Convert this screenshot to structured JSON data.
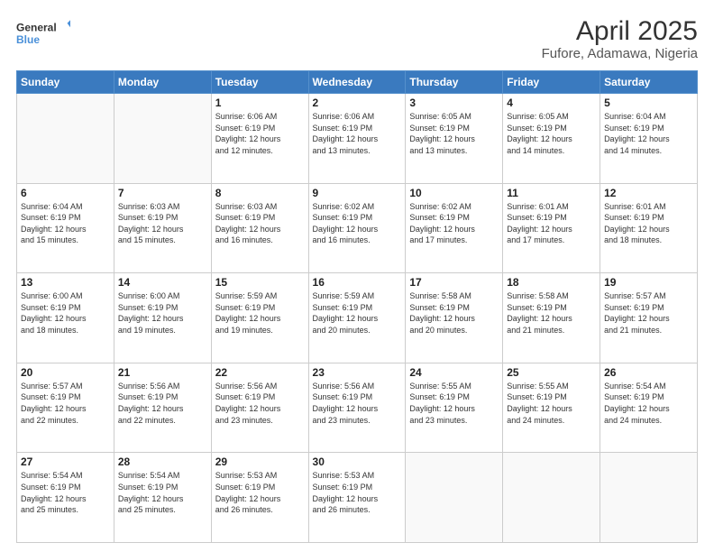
{
  "header": {
    "logo_line1": "General",
    "logo_line2": "Blue",
    "title": "April 2025",
    "subtitle": "Fufore, Adamawa, Nigeria"
  },
  "days_of_week": [
    "Sunday",
    "Monday",
    "Tuesday",
    "Wednesday",
    "Thursday",
    "Friday",
    "Saturday"
  ],
  "weeks": [
    [
      {
        "day": "",
        "info": ""
      },
      {
        "day": "",
        "info": ""
      },
      {
        "day": "1",
        "info": "Sunrise: 6:06 AM\nSunset: 6:19 PM\nDaylight: 12 hours\nand 12 minutes."
      },
      {
        "day": "2",
        "info": "Sunrise: 6:06 AM\nSunset: 6:19 PM\nDaylight: 12 hours\nand 13 minutes."
      },
      {
        "day": "3",
        "info": "Sunrise: 6:05 AM\nSunset: 6:19 PM\nDaylight: 12 hours\nand 13 minutes."
      },
      {
        "day": "4",
        "info": "Sunrise: 6:05 AM\nSunset: 6:19 PM\nDaylight: 12 hours\nand 14 minutes."
      },
      {
        "day": "5",
        "info": "Sunrise: 6:04 AM\nSunset: 6:19 PM\nDaylight: 12 hours\nand 14 minutes."
      }
    ],
    [
      {
        "day": "6",
        "info": "Sunrise: 6:04 AM\nSunset: 6:19 PM\nDaylight: 12 hours\nand 15 minutes."
      },
      {
        "day": "7",
        "info": "Sunrise: 6:03 AM\nSunset: 6:19 PM\nDaylight: 12 hours\nand 15 minutes."
      },
      {
        "day": "8",
        "info": "Sunrise: 6:03 AM\nSunset: 6:19 PM\nDaylight: 12 hours\nand 16 minutes."
      },
      {
        "day": "9",
        "info": "Sunrise: 6:02 AM\nSunset: 6:19 PM\nDaylight: 12 hours\nand 16 minutes."
      },
      {
        "day": "10",
        "info": "Sunrise: 6:02 AM\nSunset: 6:19 PM\nDaylight: 12 hours\nand 17 minutes."
      },
      {
        "day": "11",
        "info": "Sunrise: 6:01 AM\nSunset: 6:19 PM\nDaylight: 12 hours\nand 17 minutes."
      },
      {
        "day": "12",
        "info": "Sunrise: 6:01 AM\nSunset: 6:19 PM\nDaylight: 12 hours\nand 18 minutes."
      }
    ],
    [
      {
        "day": "13",
        "info": "Sunrise: 6:00 AM\nSunset: 6:19 PM\nDaylight: 12 hours\nand 18 minutes."
      },
      {
        "day": "14",
        "info": "Sunrise: 6:00 AM\nSunset: 6:19 PM\nDaylight: 12 hours\nand 19 minutes."
      },
      {
        "day": "15",
        "info": "Sunrise: 5:59 AM\nSunset: 6:19 PM\nDaylight: 12 hours\nand 19 minutes."
      },
      {
        "day": "16",
        "info": "Sunrise: 5:59 AM\nSunset: 6:19 PM\nDaylight: 12 hours\nand 20 minutes."
      },
      {
        "day": "17",
        "info": "Sunrise: 5:58 AM\nSunset: 6:19 PM\nDaylight: 12 hours\nand 20 minutes."
      },
      {
        "day": "18",
        "info": "Sunrise: 5:58 AM\nSunset: 6:19 PM\nDaylight: 12 hours\nand 21 minutes."
      },
      {
        "day": "19",
        "info": "Sunrise: 5:57 AM\nSunset: 6:19 PM\nDaylight: 12 hours\nand 21 minutes."
      }
    ],
    [
      {
        "day": "20",
        "info": "Sunrise: 5:57 AM\nSunset: 6:19 PM\nDaylight: 12 hours\nand 22 minutes."
      },
      {
        "day": "21",
        "info": "Sunrise: 5:56 AM\nSunset: 6:19 PM\nDaylight: 12 hours\nand 22 minutes."
      },
      {
        "day": "22",
        "info": "Sunrise: 5:56 AM\nSunset: 6:19 PM\nDaylight: 12 hours\nand 23 minutes."
      },
      {
        "day": "23",
        "info": "Sunrise: 5:56 AM\nSunset: 6:19 PM\nDaylight: 12 hours\nand 23 minutes."
      },
      {
        "day": "24",
        "info": "Sunrise: 5:55 AM\nSunset: 6:19 PM\nDaylight: 12 hours\nand 23 minutes."
      },
      {
        "day": "25",
        "info": "Sunrise: 5:55 AM\nSunset: 6:19 PM\nDaylight: 12 hours\nand 24 minutes."
      },
      {
        "day": "26",
        "info": "Sunrise: 5:54 AM\nSunset: 6:19 PM\nDaylight: 12 hours\nand 24 minutes."
      }
    ],
    [
      {
        "day": "27",
        "info": "Sunrise: 5:54 AM\nSunset: 6:19 PM\nDaylight: 12 hours\nand 25 minutes."
      },
      {
        "day": "28",
        "info": "Sunrise: 5:54 AM\nSunset: 6:19 PM\nDaylight: 12 hours\nand 25 minutes."
      },
      {
        "day": "29",
        "info": "Sunrise: 5:53 AM\nSunset: 6:19 PM\nDaylight: 12 hours\nand 26 minutes."
      },
      {
        "day": "30",
        "info": "Sunrise: 5:53 AM\nSunset: 6:19 PM\nDaylight: 12 hours\nand 26 minutes."
      },
      {
        "day": "",
        "info": ""
      },
      {
        "day": "",
        "info": ""
      },
      {
        "day": "",
        "info": ""
      }
    ]
  ]
}
